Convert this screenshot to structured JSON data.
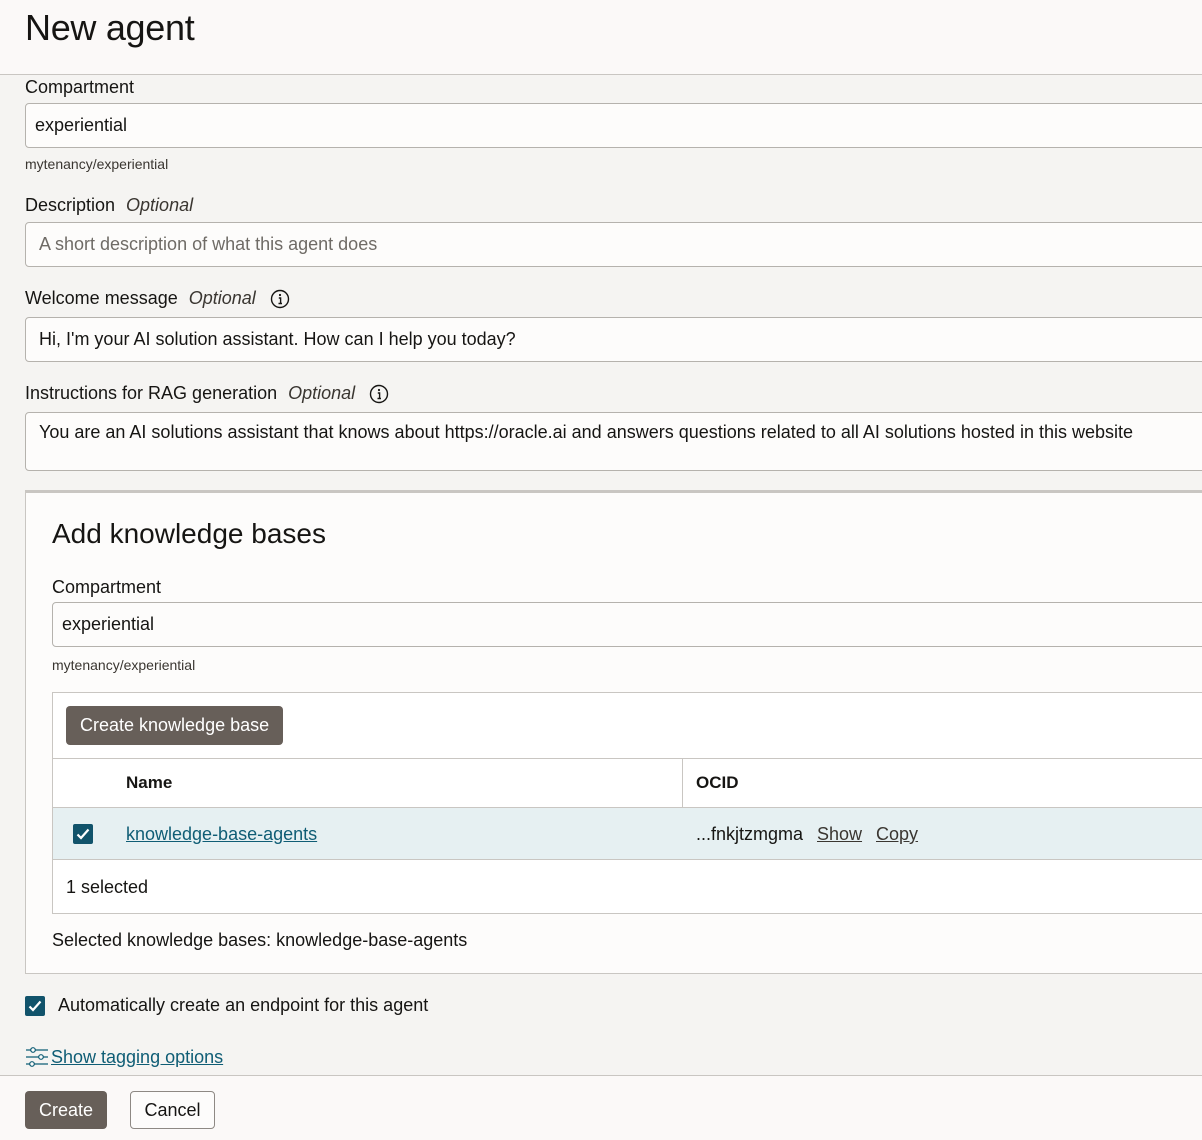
{
  "page": {
    "title": "New agent"
  },
  "form": {
    "compartment": {
      "label": "Compartment",
      "value": "experiential",
      "path": "mytenancy/experiential"
    },
    "description": {
      "label": "Description",
      "optional": "Optional",
      "placeholder": "A short description of what this agent does"
    },
    "welcome": {
      "label": "Welcome message",
      "optional": "Optional",
      "value": "Hi, I'm your AI solution assistant. How can I help you today?"
    },
    "instructions": {
      "label": "Instructions for RAG generation",
      "optional": "Optional",
      "value": "You are an AI solutions assistant that knows about https://oracle.ai and answers questions related to all AI solutions hosted in this website"
    }
  },
  "knowledge_bases": {
    "title": "Add knowledge bases",
    "compartment_label": "Compartment",
    "compartment_value": "experiential",
    "compartment_path": "mytenancy/experiential",
    "create_button": "Create knowledge base",
    "columns": {
      "name": "Name",
      "ocid": "OCID"
    },
    "rows": [
      {
        "name": "knowledge-base-agents",
        "ocid": "...fnkjtzmgma",
        "show": "Show",
        "copy": "Copy",
        "checked": true
      }
    ],
    "selected_count": "1 selected",
    "selected_summary": "Selected knowledge bases: knowledge-base-agents"
  },
  "options": {
    "auto_endpoint": "Automatically create an endpoint for this agent",
    "tagging_link": "Show tagging options"
  },
  "footer": {
    "create": "Create",
    "cancel": "Cancel"
  },
  "colors": {
    "primary_button": "#675f59",
    "checkbox": "#11536b",
    "link": "#0f5d75",
    "row_selected": "#e6f0f2"
  }
}
